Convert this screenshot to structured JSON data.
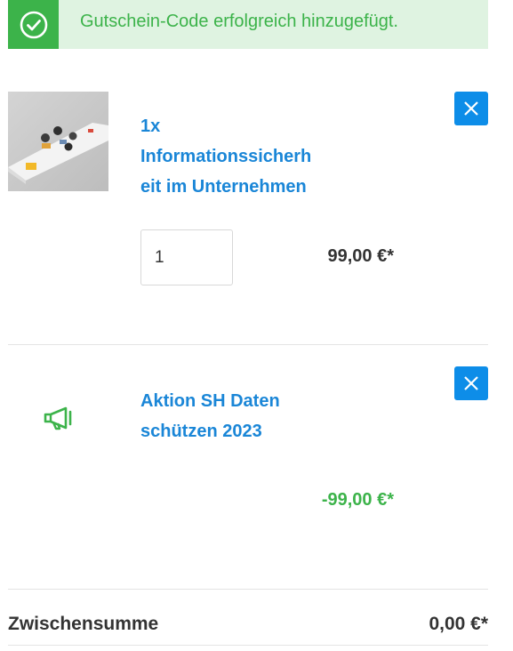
{
  "alert": {
    "message": "Gutschein-Code erfolgreich hinzugefügt.",
    "icon": "check-circle-icon",
    "color": "#3cb34a"
  },
  "items": [
    {
      "title_lines": [
        "1x",
        "Informationssicherh",
        "eit im Unternehmen"
      ],
      "quantity": "1",
      "price": "99,00 €*",
      "remove_icon": "close-icon"
    },
    {
      "title_lines": [
        "Aktion SH Daten",
        "schützen 2023"
      ],
      "price": "-99,00 €*",
      "icon": "megaphone-icon",
      "remove_icon": "close-icon"
    }
  ],
  "summary": {
    "label": "Zwischensumme",
    "value": "0,00 €*"
  },
  "colors": {
    "accent": "#1a86d7",
    "remove_button": "#0d8de8",
    "success": "#3cb34a"
  }
}
